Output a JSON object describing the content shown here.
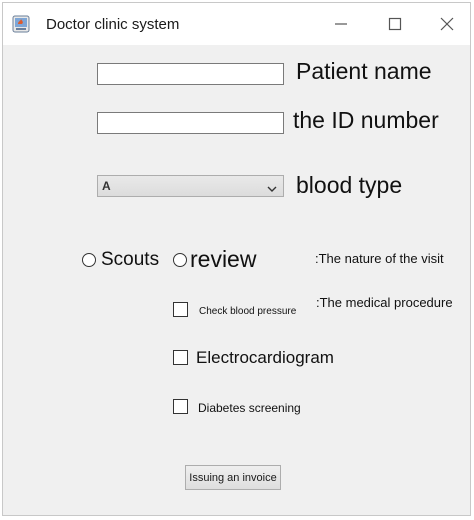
{
  "window": {
    "title": "Doctor clinic system"
  },
  "form": {
    "patient_name": {
      "value": "",
      "label": "Patient name"
    },
    "id_number": {
      "value": "",
      "label": "the ID number"
    },
    "blood_type": {
      "selected": "A",
      "label": "blood type"
    },
    "visit_nature": {
      "label": ":The nature of the visit",
      "options": [
        "Scouts",
        "review"
      ]
    },
    "procedure": {
      "label": ":The medical procedure",
      "options": [
        "Check blood pressure",
        "Electrocardiogram",
        "Diabetes screening"
      ]
    },
    "invoice_button": "Issuing an invoice"
  },
  "icons": {
    "app": "java-app-icon",
    "minimize": "minimize-icon",
    "maximize": "maximize-icon",
    "close": "close-icon",
    "dropdown": "chevron-down-icon"
  },
  "colors": {
    "window_bg": "#f0f0f0",
    "titlebar_bg": "#ffffff",
    "field_border": "#7a7a7a"
  }
}
